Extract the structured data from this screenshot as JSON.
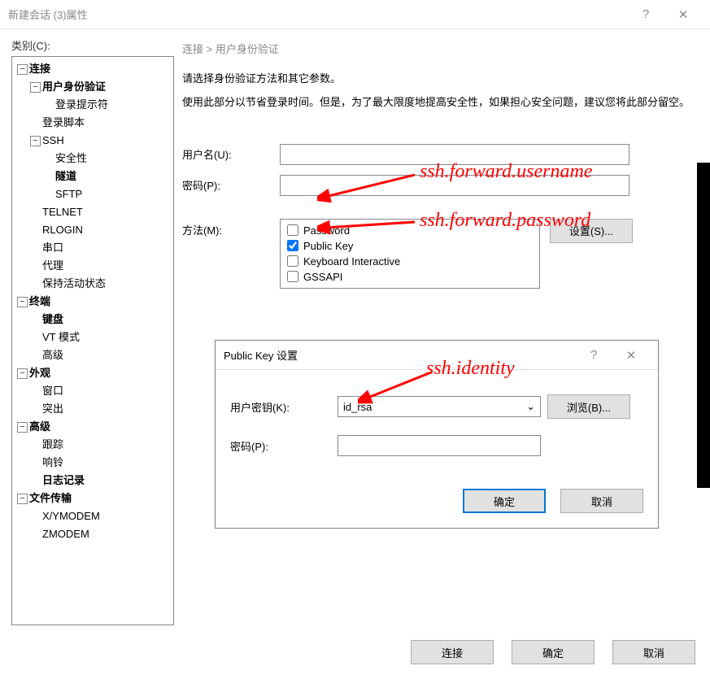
{
  "window": {
    "title": "新建会话 (3)属性",
    "help": "?",
    "close": "✕"
  },
  "category_label": "类别(C):",
  "tree": {
    "connection": "连接",
    "userauth": "用户身份验证",
    "loginprompt": "登录提示符",
    "loginscript": "登录脚本",
    "ssh": "SSH",
    "security": "安全性",
    "tunnel": "隧道",
    "sftp": "SFTP",
    "telnet": "TELNET",
    "rlogin": "RLOGIN",
    "serial": "串口",
    "proxy": "代理",
    "keepalive": "保持活动状态",
    "terminal": "终端",
    "keyboard": "键盘",
    "vtmode": "VT 模式",
    "advanced_term": "高级",
    "appearance": "外观",
    "window": "窗口",
    "popout": "突出",
    "advanced": "高级",
    "trace": "跟踪",
    "bell": "响铃",
    "logging": "日志记录",
    "filetransfer": "文件传输",
    "xymodem": "X/YMODEM",
    "zmodem": "ZMODEM"
  },
  "main": {
    "breadcrumb": "连接 > 用户身份验证",
    "desc1": "请选择身份验证方法和其它参数。",
    "desc2": "使用此部分以节省登录时间。但是，为了最大限度地提高安全性，如果担心安全问题，建议您将此部分留空。",
    "username_label": "用户名(U):",
    "password_label": "密码(P):",
    "method_label": "方法(M):",
    "methods": {
      "password": "Password",
      "publickey": "Public Key",
      "keyboard": "Keyboard Interactive",
      "gssapi": "GSSAPI"
    },
    "settings_btn": "设置(S)..."
  },
  "dialog": {
    "title": "Public Key 设置",
    "help": "?",
    "close": "✕",
    "userkey_label": "用户密钥(K):",
    "userkey_value": "id_rsa",
    "browse_btn": "浏览(B)...",
    "password_label": "密码(P):",
    "ok": "确定",
    "cancel": "取消"
  },
  "footer": {
    "connect": "连接",
    "ok": "确定",
    "cancel": "取消"
  },
  "annotations": {
    "a1": "ssh.forward.username",
    "a2": "ssh.forward.password",
    "a3": "ssh.identity"
  }
}
